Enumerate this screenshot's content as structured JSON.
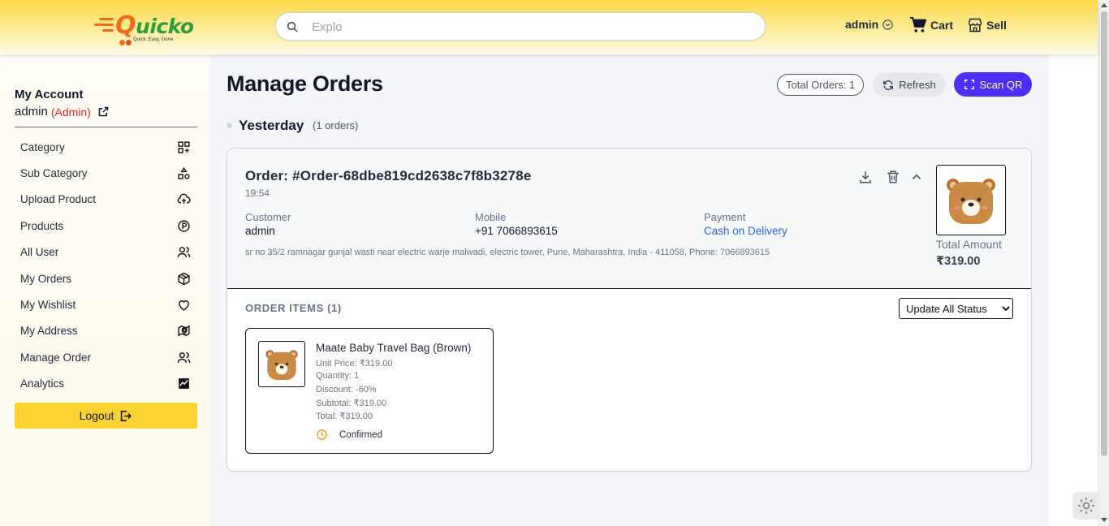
{
  "brand": {
    "name_first": "Q",
    "name_rest": "uicko",
    "tagline": "Quick. Easy. Done",
    "primary": "#fcd232",
    "accent": "#4f2df5"
  },
  "header": {
    "search_placeholder": "Explo",
    "user_label": "admin",
    "cart_label": "Cart",
    "sell_label": "Sell"
  },
  "sidebar": {
    "title": "My Account",
    "username": "admin",
    "role": "(Admin)",
    "items": [
      {
        "label": "Category",
        "icon": "category-grid-icon"
      },
      {
        "label": "Sub Category",
        "icon": "shapes-icon"
      },
      {
        "label": "Upload Product",
        "icon": "cloud-upload-icon"
      },
      {
        "label": "Products",
        "icon": "product-circle-icon"
      },
      {
        "label": "All User",
        "icon": "users-icon"
      },
      {
        "label": "My Orders",
        "icon": "package-icon"
      },
      {
        "label": "My Wishlist",
        "icon": "heart-icon"
      },
      {
        "label": "My Address",
        "icon": "map-pin-icon"
      },
      {
        "label": "Manage Order",
        "icon": "users-icon"
      },
      {
        "label": "Analytics",
        "icon": "chart-icon"
      }
    ],
    "logout_label": "Logout"
  },
  "main": {
    "title": "Manage Orders",
    "total_orders": "Total Orders: 1",
    "refresh_label": "Refresh",
    "scan_label": "Scan QR",
    "group": {
      "label": "Yesterday",
      "count": "(1 orders)"
    },
    "order": {
      "id": "Order: #Order-68dbe819cd2638c7f8b3278e",
      "time": "19:54",
      "customer_label": "Customer",
      "customer": "admin",
      "mobile_label": "Mobile",
      "mobile": "+91 7066893615",
      "payment_label": "Payment",
      "payment": "Cash on Delivery",
      "address": "sr no 35/2 ramnagar gunjal wasti near electric warje malwadi, electric tower, Pune, Maharashtra, India - 411058, Phone: 7066893615",
      "total_label": "Total Amount",
      "total": "₹319.00",
      "items_label": "ORDER ITEMS (1)",
      "status_select": "Update All Status",
      "items": [
        {
          "name": "Maate Baby Travel Bag (Brown)",
          "unit_price": "Unit Price: ₹319.00",
          "quantity": "Quantity: 1",
          "discount": "Discount: -60%",
          "subtotal": "Subtotal: ₹319.00",
          "total": "Total: ₹319.00",
          "status": "Confirmed"
        }
      ]
    }
  }
}
